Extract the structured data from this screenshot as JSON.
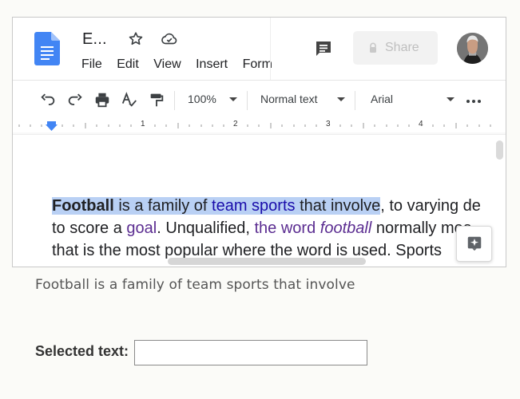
{
  "header": {
    "doc_title": "E...",
    "menu": [
      "File",
      "Edit",
      "View",
      "Insert",
      "Form"
    ],
    "share_label": "Share"
  },
  "toolbar": {
    "zoom": "100%",
    "text_style": "Normal text",
    "font": "Arial"
  },
  "ruler": {
    "labels": [
      "1",
      "2",
      "3",
      "4"
    ]
  },
  "document": {
    "line1": {
      "selected_bold": "Football",
      "selected_text_1": " is a family of ",
      "selected_link": "team sports",
      "selected_text_2": " that involve",
      "unselected_text": ", to varying de"
    },
    "line2": {
      "text_1": "to score a ",
      "link_goal": "goal",
      "text_2": ". Unqualified, ",
      "link_phrase": "the word ",
      "italic_football": "football",
      "text_3": " normally mea"
    },
    "line3": {
      "text": "that is the most popular where the word is used. Sports"
    }
  },
  "caption": "Football is a family of team sports that involve",
  "form": {
    "label": "Selected text:",
    "input_value": "",
    "input_placeholder": ""
  },
  "icons": {
    "document": "google-docs-icon",
    "star": "star-icon",
    "cloud": "cloud-check-icon",
    "comment": "comment-icon",
    "lock": "lock-icon",
    "undo": "undo-icon",
    "redo": "redo-icon",
    "print": "print-icon",
    "spellcheck": "spellcheck-icon",
    "paint_format": "paint-format-icon",
    "more": "more-horizontal-icon",
    "explore": "explore-icon"
  },
  "colors": {
    "selection": "#b9d0f4",
    "docs_blue": "#4285f4",
    "link": "#1a0dab",
    "visited_link": "#5b2d91"
  }
}
